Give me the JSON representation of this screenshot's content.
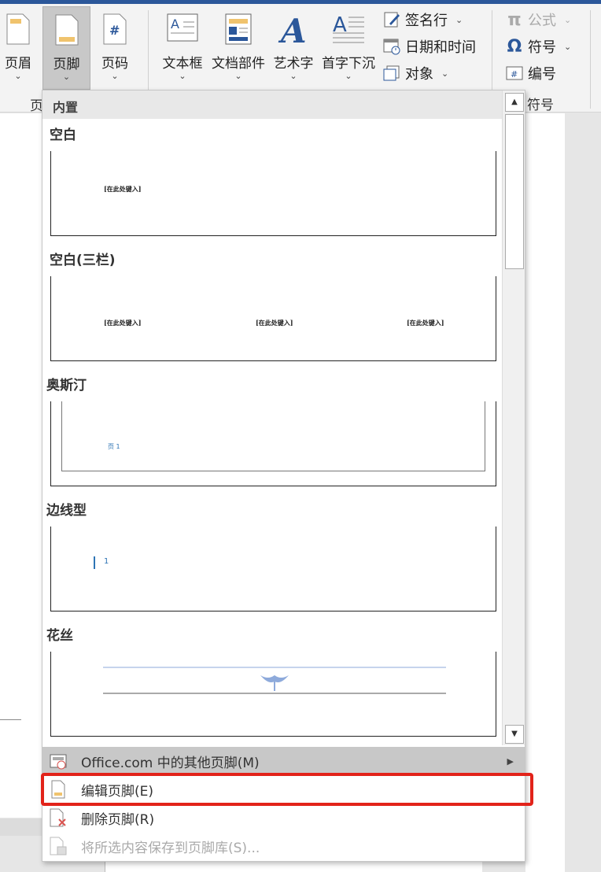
{
  "ribbon": {
    "header_btn": "页眉",
    "footer_btn": "页脚",
    "pagenum_btn": "页码",
    "textbox_btn": "文本框",
    "quickparts_btn": "文档部件",
    "wordart_btn": "艺术字",
    "dropcap_btn": "首字下沉",
    "signature_line": "签名行",
    "datetime": "日期和时间",
    "object": "对象",
    "equation": "公式",
    "symbol": "符号",
    "number": "编号",
    "group_header_footer": "页",
    "group_symbols": "符号"
  },
  "dropdown": {
    "section_title": "内置",
    "items": [
      {
        "title": "空白",
        "texts": [
          "[在此处键入]"
        ]
      },
      {
        "title": "空白(三栏)",
        "texts": [
          "[在此处键入]",
          "[在此处键入]",
          "[在此处键入]"
        ]
      },
      {
        "title": "奥斯汀",
        "texts": [
          "页 1"
        ]
      },
      {
        "title": "边线型",
        "texts": [
          "1"
        ]
      },
      {
        "title": "花丝",
        "texts": []
      }
    ],
    "menu": {
      "more": "Office.com 中的其他页脚(M)",
      "edit": "编辑页脚(E)",
      "remove": "删除页脚(R)",
      "save": "将所选内容保存到页脚库(S)..."
    }
  },
  "colors": {
    "accent": "#2b579a",
    "highlight_box": "#e2231a",
    "footer_icon": "#f0c36d",
    "austin_text": "#2e74b5"
  }
}
